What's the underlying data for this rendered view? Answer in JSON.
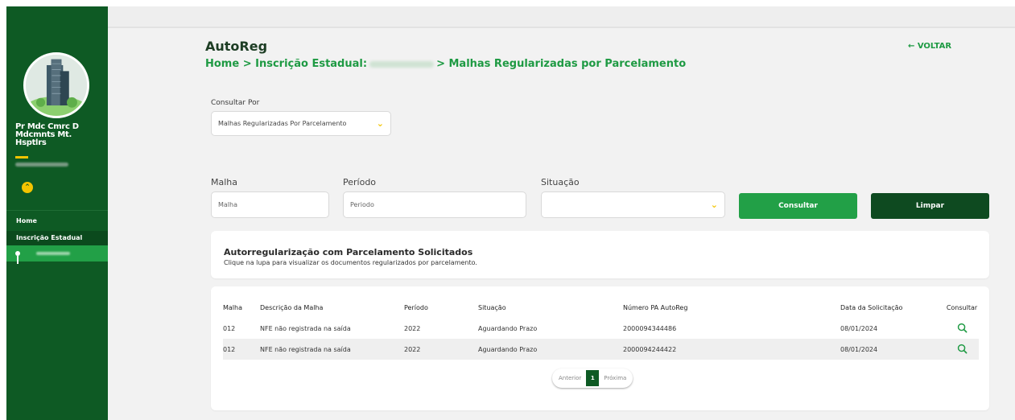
{
  "sidebar": {
    "company_name": "Pr Mdc Cmrc D Mdcmnts Mt. Hsptlrs",
    "collapse_icon": "chevron-up-icon",
    "nav": {
      "home": "Home",
      "inscricao": "Inscrição Estadual"
    }
  },
  "header": {
    "app_title": "AutoReg",
    "breadcrumb_start": "Home > Inscrição Estadual:",
    "breadcrumb_end": "> Malhas Regularizadas por Parcelamento",
    "back_label": "← VOLTAR"
  },
  "filters": {
    "consultar_por_label": "Consultar Por",
    "consultar_por_value": "Malhas Regularizadas Por Parcelamento",
    "malha_label": "Malha",
    "malha_placeholder": "Malha",
    "periodo_label": "Período",
    "periodo_placeholder": "Periodo",
    "situacao_label": "Situação",
    "situacao_value": "",
    "consultar_button": "Consultar",
    "limpar_button": "Limpar"
  },
  "info": {
    "title": "Autorregularização com Parcelamento Solicitados",
    "subtitle": "Clique na lupa para visualizar os documentos regularizados por parcelamento."
  },
  "table": {
    "headers": [
      "Malha",
      "Descrição da Malha",
      "Período",
      "Situação",
      "Número PA AutoReg",
      "Data da Solicitação",
      "Consultar"
    ],
    "rows": [
      [
        "012",
        "NFE não registrada na saída",
        "2022",
        "Aguardando Prazo",
        "2000094344486",
        "08/01/2024"
      ],
      [
        "012",
        "NFE não registrada na saída",
        "2022",
        "Aguardando Prazo",
        "2000094244422",
        "08/01/2024"
      ]
    ]
  },
  "pagination": {
    "previous": "Anterior",
    "current_page": "1",
    "next": "Próxima"
  },
  "colors": {
    "sidebar_bg": "#0e5a24",
    "accent_green": "#1e9a43",
    "accent_yellow": "#f3c400",
    "dark_button": "#0e4a20"
  }
}
